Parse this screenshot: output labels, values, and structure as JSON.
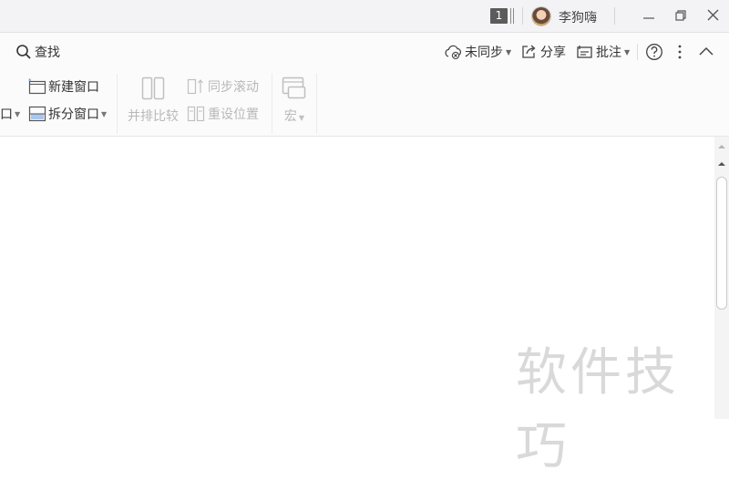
{
  "titlebar": {
    "badge": "1",
    "username": "李狗嗨",
    "icons": [
      "layout-bars-icon",
      "minimize-icon",
      "restore-icon",
      "close-icon"
    ]
  },
  "toolbar": {
    "search_label": "查找",
    "sync_label": "未同步",
    "share_label": "分享",
    "annotate_label": "批注",
    "icons": [
      "search-icon",
      "cloud-sync-icon",
      "share-icon",
      "annotate-icon",
      "help-icon",
      "more-icon",
      "collapse-icon"
    ]
  },
  "ribbon": {
    "partial_left": "口",
    "new_window": "新建窗口",
    "split_window": "拆分窗口",
    "side_by_side": "并排比较",
    "sync_scroll": "同步滚动",
    "reset_position": "重设位置",
    "macro": "宏"
  },
  "watermark": "软件技巧",
  "colors": {
    "titlebar_bg": "#f3f3f5",
    "toolbar_bg": "#fbfbfb",
    "disabled_text": "#b8b8b8"
  }
}
